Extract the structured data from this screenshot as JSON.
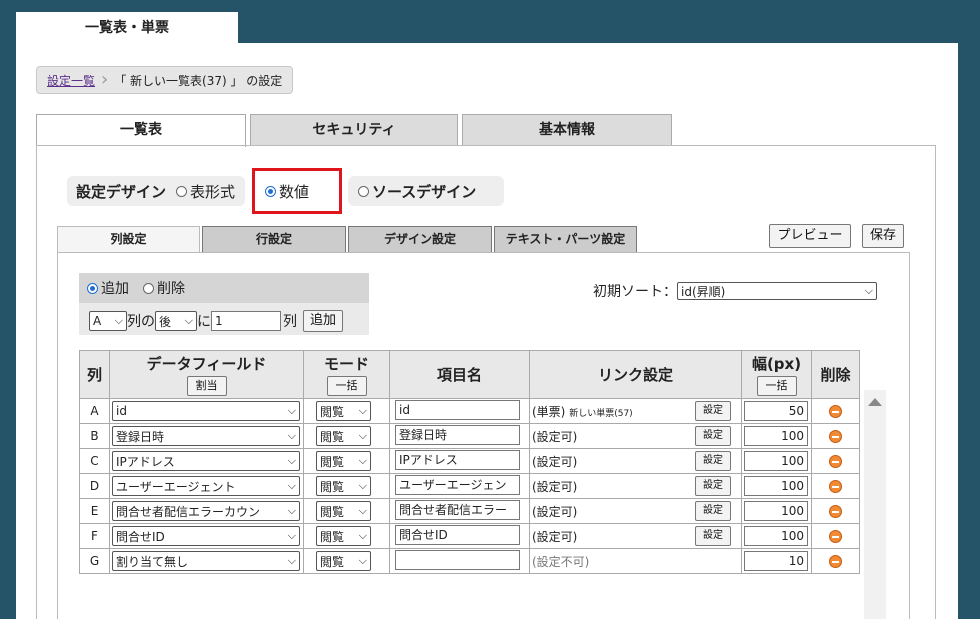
{
  "top_tab": "一覧表・単票",
  "breadcrumb": {
    "link": "設定一覧",
    "current": "「 新しい一覧表(37) 」 の設定"
  },
  "main_tabs": [
    "一覧表",
    "セキュリティ",
    "基本情報"
  ],
  "design": {
    "label": "設定デザイン",
    "opt_table": "表形式",
    "opt_number": "数値",
    "opt_source": "ソースデザイン",
    "selected": "数値"
  },
  "sub_tabs": [
    "列設定",
    "行設定",
    "デザイン設定",
    "テキスト・パーツ設定"
  ],
  "buttons": {
    "preview": "プレビュー",
    "save": "保存"
  },
  "add_panel": {
    "opt_add": "追加",
    "opt_delete": "削除",
    "col_select": "A",
    "text_col_no": "列の",
    "pos_select": "後",
    "text_ni": "に",
    "count": "1",
    "text_col": "列",
    "add_button": "追加"
  },
  "sort": {
    "label": "初期ソート：",
    "value": "id(昇順)"
  },
  "table": {
    "headers": {
      "col": "列",
      "datafield": "データフィールド",
      "mode": "モード",
      "name": "項目名",
      "link": "リンク設定",
      "width": "幅(px)",
      "delete": "削除"
    },
    "header_buttons": {
      "datafield": "割当",
      "mode": "一括",
      "width": "一括"
    },
    "set_label": "設定",
    "rows": [
      {
        "col": "A",
        "field": "id",
        "mode": "閲覧",
        "name": "id",
        "link": "(単票)",
        "link_sub": "新しい単票(57)",
        "width": "50"
      },
      {
        "col": "B",
        "field": "登録日時",
        "mode": "閲覧",
        "name": "登録日時",
        "link": "(設定可)",
        "link_sub": "",
        "width": "100"
      },
      {
        "col": "C",
        "field": "IPアドレス",
        "mode": "閲覧",
        "name": "IPアドレス",
        "link": "(設定可)",
        "link_sub": "",
        "width": "100"
      },
      {
        "col": "D",
        "field": "ユーザーエージェント",
        "mode": "閲覧",
        "name": "ユーザーエージェン",
        "link": "(設定可)",
        "link_sub": "",
        "width": "100"
      },
      {
        "col": "E",
        "field": "問合せ者配信エラーカウン",
        "mode": "閲覧",
        "name": "問合せ者配信エラー",
        "link": "(設定可)",
        "link_sub": "",
        "width": "100"
      },
      {
        "col": "F",
        "field": "問合せID",
        "mode": "閲覧",
        "name": "問合せID",
        "link": "(設定可)",
        "link_sub": "",
        "width": "100"
      },
      {
        "col": "G",
        "field": "割り当て無し",
        "mode": "閲覧",
        "name": "",
        "link": "(設定不可)",
        "link_sub": "",
        "width": "10"
      }
    ]
  },
  "colors": {
    "frame": "#255469",
    "highlight": "#e0141c",
    "delete_icon": "#f08a33",
    "link": "#5a2f8a"
  }
}
